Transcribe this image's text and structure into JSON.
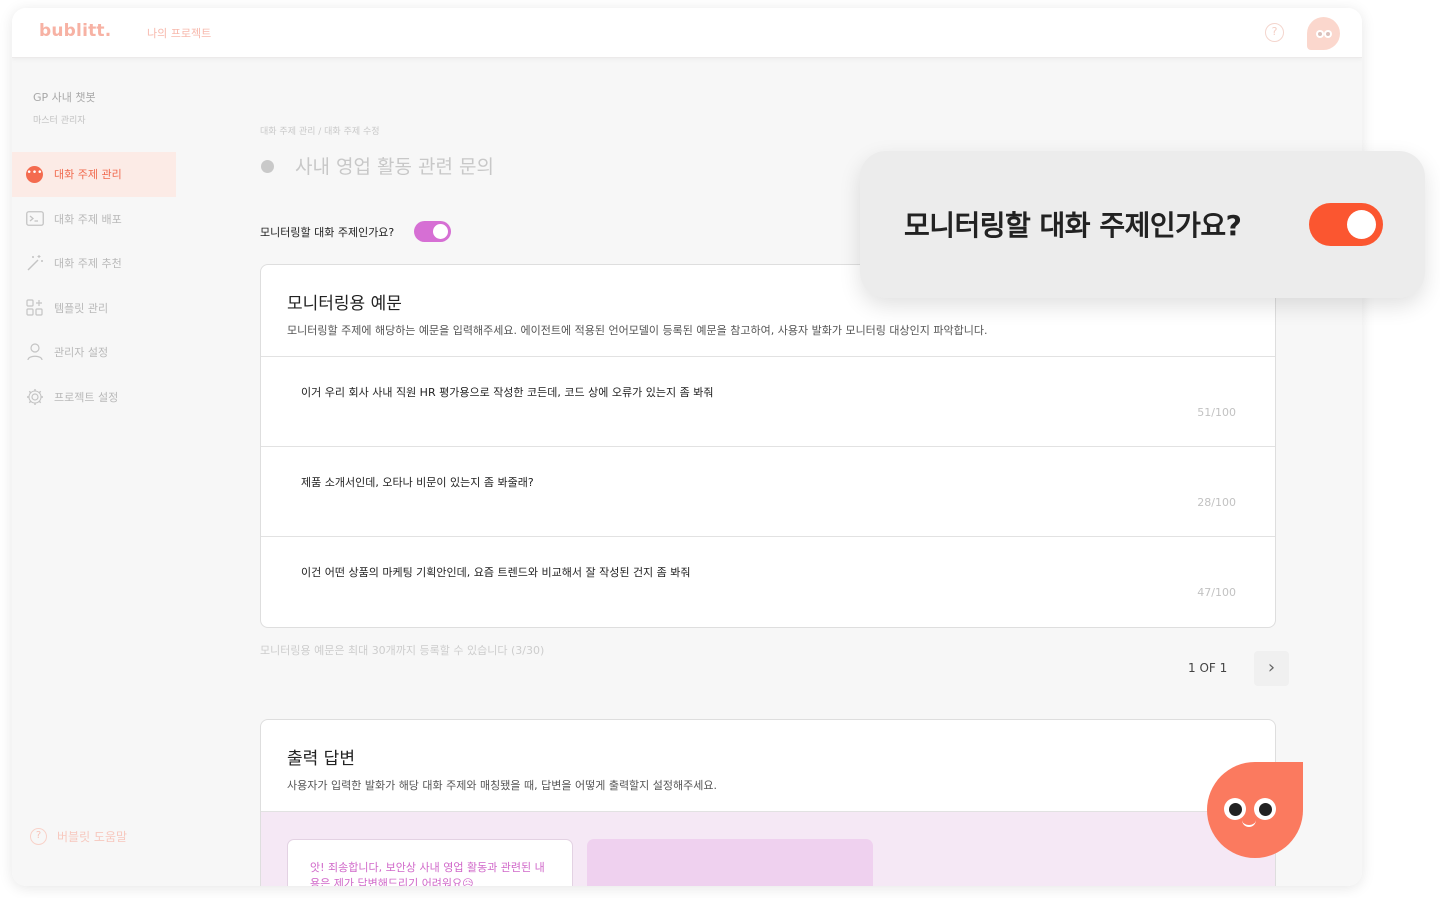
{
  "topbar": {
    "logo": "bublitt.",
    "project_link": "나의 프로젝트",
    "help_icon": "?"
  },
  "sidebar": {
    "org_name": "GP 사내 챗봇",
    "org_role": "마스터 관리자",
    "items": [
      {
        "label": "대화 주제 관리",
        "icon": "chat-bubble-icon",
        "active": true
      },
      {
        "label": "대화 주제 배포",
        "icon": "terminal-icon",
        "active": false
      },
      {
        "label": "대화 주제 추천",
        "icon": "magic-wand-icon",
        "active": false
      },
      {
        "label": "템플릿 관리",
        "icon": "template-grid-icon",
        "active": false
      },
      {
        "label": "관리자 설정",
        "icon": "user-icon",
        "active": false
      },
      {
        "label": "프로젝트 설정",
        "icon": "gear-icon",
        "active": false
      }
    ],
    "help_label": "버블릿 도움말"
  },
  "main": {
    "breadcrumb": "대화 주제 관리 / 대화 주제 수정",
    "title": "사내 영업 활동 관련 문의",
    "monitor_label": "모니터링할 대화 주제인가요?",
    "monitor_enabled": true,
    "examples": {
      "title": "모니터링용 예문",
      "description": "모니터링할 주제에 해당하는 예문을 입력해주세요. 에이전트에 적용된 언어모델이 등록된 예문을 참고하여, 사용자 발화가 모니터링 대상인지 파악합니다.",
      "rows": [
        {
          "text": "이거 우리 회사 사내 직원 HR 평가용으로 작성한 코든데, 코드 상에 오류가 있는지 좀 봐줘",
          "count": "51/100"
        },
        {
          "text": "제품 소개서인데, 오타나 비문이 있는지 좀 봐줄래?",
          "count": "28/100"
        },
        {
          "text": "이건 어떤 상품의 마케팅 기획안인데, 요즘 트렌드와 비교해서 잘 작성된 건지 좀 봐줘",
          "count": "47/100"
        }
      ],
      "footnote": "모니터링용 예문은 최대 30개까지 등록할 수 있습니다 (3/30)",
      "pager": "1 OF 1",
      "next_icon": "›"
    },
    "output": {
      "title": "출력 답변",
      "description": "사용자가 입력한 발화가 해당 대화 주제와 매칭됐을 때, 답변을 어떻게 출력할지 설정해주세요.",
      "answer": "앗! 죄송합니다, 보안상 사내 영업 활동과 관련된 내용은 제가 답변해드리기 어려워요😥"
    }
  },
  "popup": {
    "text": "모니터링할 대화 주제인가요?",
    "enabled": true
  },
  "colors": {
    "accent": "#f46b4f",
    "toggle_small": "#d66fd4",
    "toggle_big": "#fb5630",
    "mascot": "#fb7a5f"
  }
}
